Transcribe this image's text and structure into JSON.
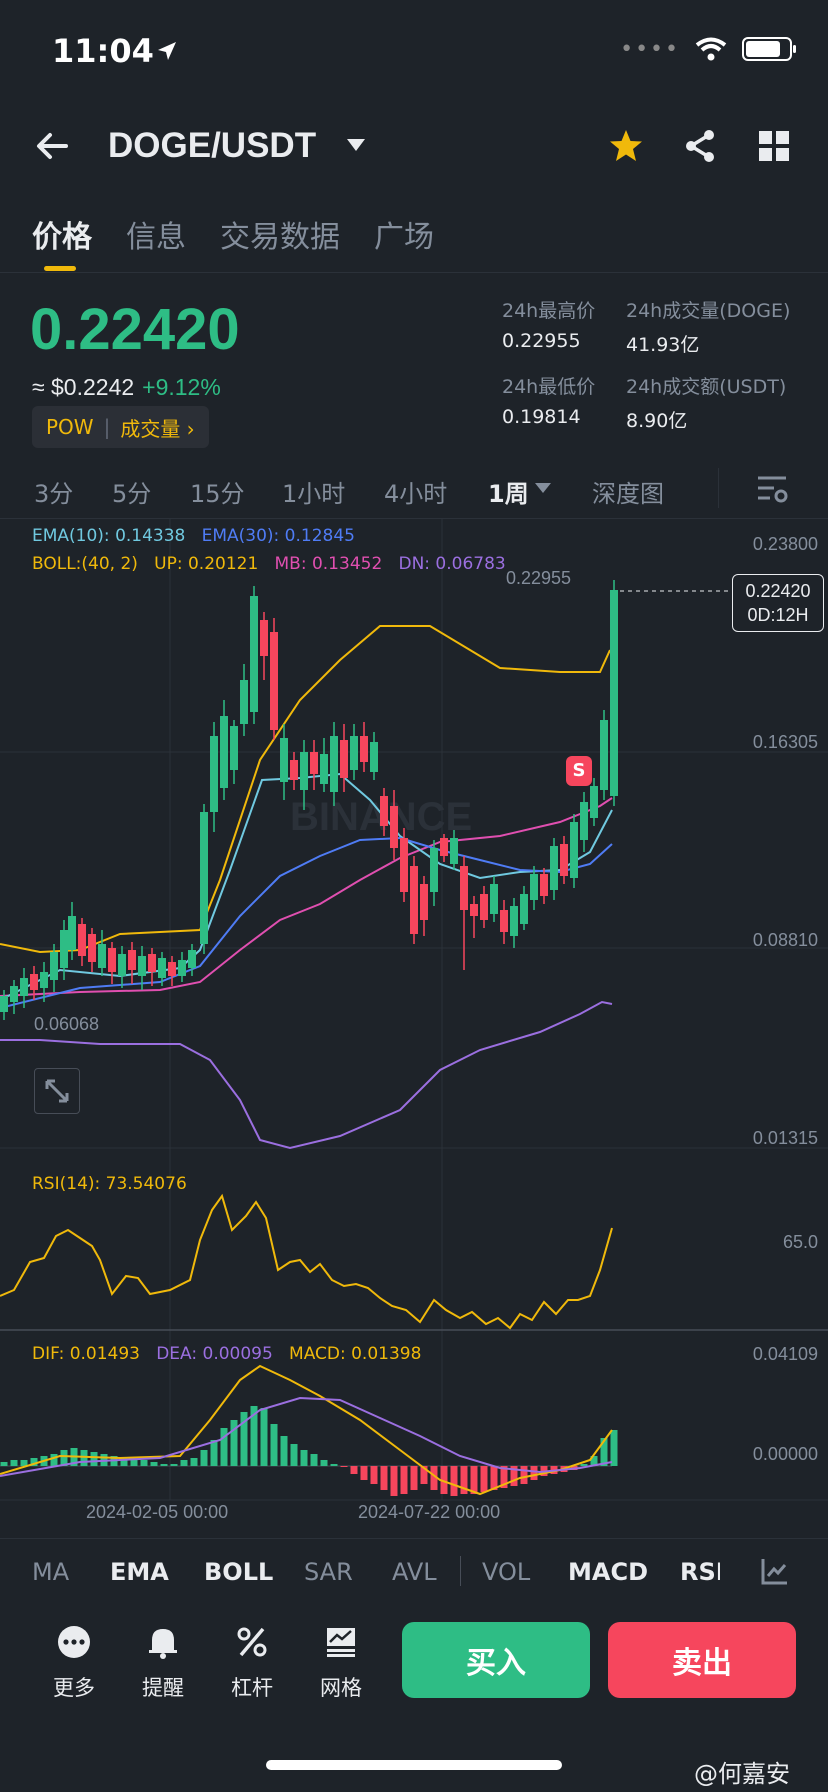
{
  "status": {
    "time": "11:04"
  },
  "header": {
    "pair": "DOGE/USDT"
  },
  "tabs": [
    "价格",
    "信息",
    "交易数据",
    "广场"
  ],
  "price": {
    "last": "0.22420",
    "usd": "≈ $0.2242",
    "change": "+9.12%"
  },
  "tags": {
    "pow": "POW",
    "volume": "成交量 ›"
  },
  "stats": {
    "high_label": "24h最高价",
    "high": "0.22955",
    "low_label": "24h最低价",
    "low": "0.19814",
    "vol_doge_label": "24h成交量(DOGE)",
    "vol_doge": "41.93亿",
    "vol_usdt_label": "24h成交额(USDT)",
    "vol_usdt": "8.90亿"
  },
  "timeframes": [
    "3分",
    "5分",
    "15分",
    "1小时",
    "4小时",
    "1周",
    "深度图"
  ],
  "legend": {
    "ema10": "EMA(10): 0.14338",
    "ema30": "EMA(30): 0.12845",
    "boll": "BOLL:(40, 2)",
    "up": "UP: 0.20121",
    "mb": "MB: 0.13452",
    "dn": "DN: 0.06783",
    "rsi": "RSI(14): 73.54076",
    "dif": "DIF: 0.01493",
    "dea": "DEA: 0.00095",
    "macd": "MACD: 0.01398"
  },
  "axis": {
    "p1": "0.23800",
    "p2": "0.16305",
    "p3": "0.08810",
    "p4": "0.01315",
    "rsi": "65.0",
    "m1": "0.04109",
    "m2": "0.00000",
    "high_mark": "0.22955",
    "low_mark": "0.06068",
    "cur_price": "0.22420",
    "countdown": "0D:12H",
    "d1": "2024-02-05 00:00",
    "d2": "2024-07-22 00:00",
    "sell_marker": "S",
    "watermark": "BINANCE"
  },
  "indicators": [
    "MA",
    "EMA",
    "BOLL",
    "SAR",
    "AVL",
    "VOL",
    "MACD",
    "RSI"
  ],
  "tools": [
    "更多",
    "提醒",
    "杠杆",
    "网格"
  ],
  "actions": {
    "buy": "买入",
    "sell": "卖出"
  },
  "credit": "@何嘉安",
  "colors": {
    "up": "#2ebd85",
    "down": "#f6465d",
    "accent": "#f0b90b",
    "bg": "#1e2329"
  }
}
